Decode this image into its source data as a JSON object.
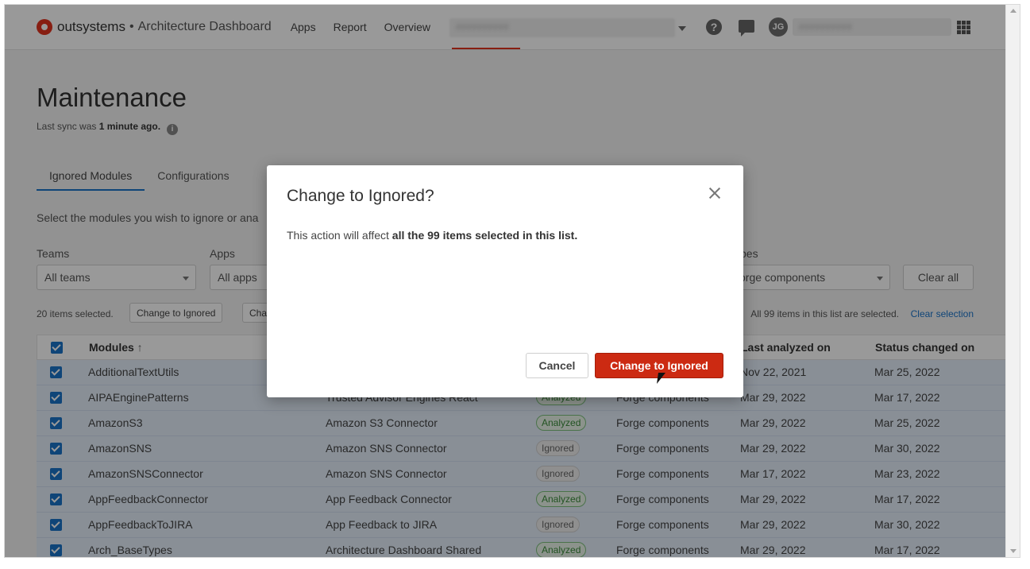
{
  "header": {
    "brand": "outsystems",
    "separator": "•",
    "product": "Architecture Dashboard",
    "nav": [
      "Apps",
      "Report",
      "Overview"
    ],
    "environment": "##########",
    "avatar_initials": "JG",
    "user_name": "##########"
  },
  "page": {
    "title": "Maintenance",
    "sync_prefix": "Last sync was ",
    "sync_time": "1 minute ago.",
    "tabs": [
      "Ignored Modules",
      "Configurations"
    ],
    "instructions": "Select the modules you wish to ignore or ana"
  },
  "filters": {
    "teams_label": "Teams",
    "teams_value": "All teams",
    "apps_label": "Apps",
    "apps_value": "All apps",
    "types_label": "pes",
    "types_value": "orge components",
    "clear_all": "Clear all"
  },
  "selection": {
    "count": "20 items selected.",
    "change_ignored": "Change to Ignored",
    "change_other": "Cha",
    "all_selected": "All 99 items in this list are selected.",
    "clear_selection": "Clear selection"
  },
  "table": {
    "headers": {
      "modules": "Modules",
      "sort_icon": "↑",
      "last_analyzed": "Last analyzed on",
      "status_changed": "Status changed on"
    },
    "rows": [
      {
        "module": "AdditionalTextUtils",
        "app": "",
        "status": "",
        "type": "",
        "analyzed": "Nov 22, 2021",
        "changed": "Mar 25, 2022"
      },
      {
        "module": "AIPAEnginePatterns",
        "app": "Trusted Advisor Engines React",
        "status": "Analyzed",
        "type": "Forge components",
        "analyzed": "Mar 29, 2022",
        "changed": "Mar 17, 2022"
      },
      {
        "module": "AmazonS3",
        "app": "Amazon S3 Connector",
        "status": "Analyzed",
        "type": "Forge components",
        "analyzed": "Mar 29, 2022",
        "changed": "Mar 25, 2022"
      },
      {
        "module": "AmazonSNS",
        "app": "Amazon SNS Connector",
        "status": "Ignored",
        "type": "Forge components",
        "analyzed": "Mar 29, 2022",
        "changed": "Mar 30, 2022"
      },
      {
        "module": "AmazonSNSConnector",
        "app": "Amazon SNS Connector",
        "status": "Ignored",
        "type": "Forge components",
        "analyzed": "Mar 17, 2022",
        "changed": "Mar 23, 2022"
      },
      {
        "module": "AppFeedbackConnector",
        "app": "App Feedback Connector",
        "status": "Analyzed",
        "type": "Forge components",
        "analyzed": "Mar 29, 2022",
        "changed": "Mar 17, 2022"
      },
      {
        "module": "AppFeedbackToJIRA",
        "app": "App Feedback to JIRA",
        "status": "Ignored",
        "type": "Forge components",
        "analyzed": "Mar 29, 2022",
        "changed": "Mar 30, 2022"
      },
      {
        "module": "Arch_BaseTypes",
        "app": "Architecture Dashboard Shared",
        "status": "Analyzed",
        "type": "Forge components",
        "analyzed": "Mar 29, 2022",
        "changed": "Mar 17, 2022"
      }
    ]
  },
  "modal": {
    "title": "Change to Ignored?",
    "body_prefix": "This action will affect ",
    "body_bold": "all the 99 items selected in this list.",
    "cancel": "Cancel",
    "confirm": "Change to Ignored"
  },
  "colors": {
    "brand": "#e2321e",
    "accent": "#1a73c8",
    "confirm": "#cc2a12"
  }
}
